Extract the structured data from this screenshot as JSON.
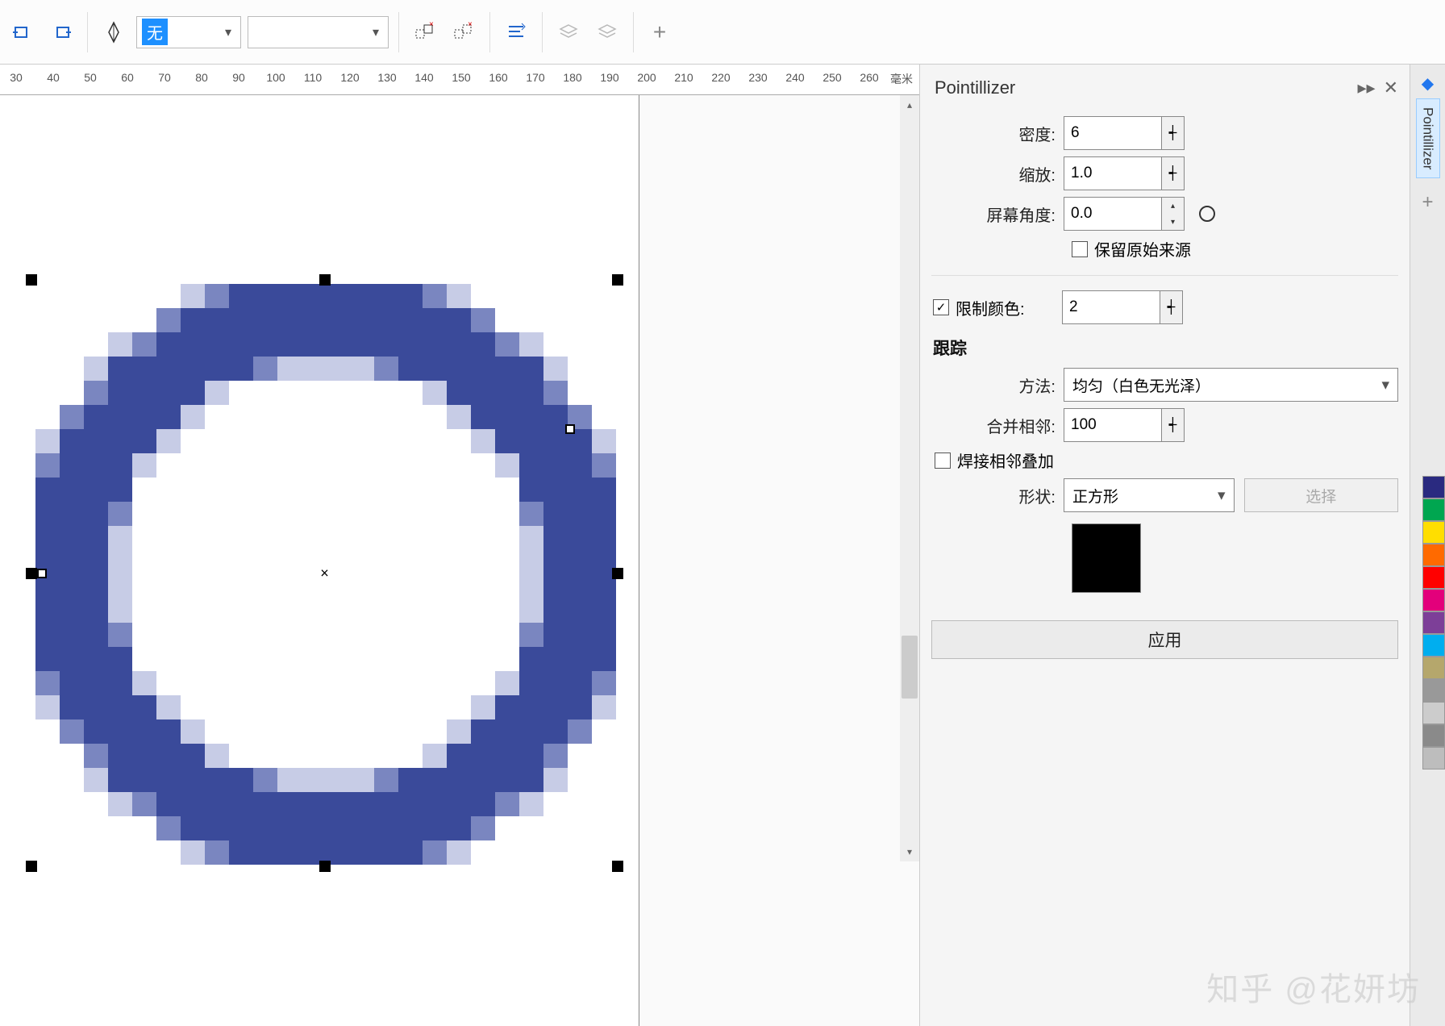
{
  "toolbar": {
    "fill_label": "无",
    "plus": "+"
  },
  "ruler": {
    "ticks": [
      30,
      40,
      50,
      60,
      70,
      80,
      90,
      100,
      110,
      120,
      130,
      140,
      150,
      160,
      170,
      180,
      190,
      200,
      210,
      220,
      230,
      240,
      250,
      260
    ],
    "unit": "毫米"
  },
  "panel": {
    "title": "Pointillizer",
    "density_lbl": "密度:",
    "density_val": "6",
    "scale_lbl": "缩放:",
    "scale_val": "1.0",
    "angle_lbl": "屏幕角度:",
    "angle_val": "0.0",
    "keep_original": "保留原始来源",
    "limit_colors": "限制颜色:",
    "limit_val": "2",
    "tracking": "跟踪",
    "method_lbl": "方法:",
    "method_val": "均匀（白色无光泽）",
    "merge_lbl": "合并相邻:",
    "merge_val": "100",
    "weld": "焊接相邻叠加",
    "shape_lbl": "形状:",
    "shape_val": "正方形",
    "select_btn": "选择",
    "apply": "应用"
  },
  "rail_tab": "Pointillizer",
  "colors": [
    "#2a2a80",
    "#00a650",
    "#ffde00",
    "#ff6a00",
    "#ff0000",
    "#e3007b",
    "#7d3f98",
    "#00aeef",
    "#b5a76c",
    "#999999",
    "#cccccc",
    "#8a8a8a",
    "#bdbdbd"
  ],
  "watermark": "知乎 @花妍坊"
}
